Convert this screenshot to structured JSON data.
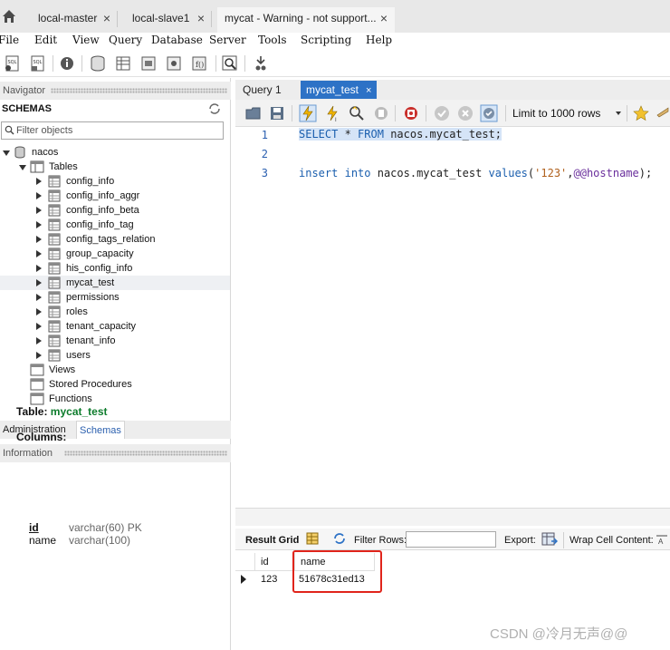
{
  "connection_tabs": [
    {
      "label": "local-master",
      "active": false
    },
    {
      "label": "local-slave1",
      "active": false
    },
    {
      "label": "mycat - Warning - not support...",
      "active": true
    }
  ],
  "menu": [
    "File",
    "Edit",
    "View",
    "Query",
    "Database",
    "Server",
    "Tools",
    "Scripting",
    "Help"
  ],
  "navigator": {
    "header": "Navigator",
    "schemas_title": "SCHEMAS",
    "filter_placeholder": "Filter objects",
    "schema_name": "nacos",
    "tables_label": "Tables",
    "tables": [
      "config_info",
      "config_info_aggr",
      "config_info_beta",
      "config_info_tag",
      "config_tags_relation",
      "group_capacity",
      "his_config_info",
      "mycat_test",
      "permissions",
      "roles",
      "tenant_capacity",
      "tenant_info",
      "users"
    ],
    "selected_table": "mycat_test",
    "views_label": "Views",
    "procedures_label": "Stored Procedures",
    "functions_label": "Functions"
  },
  "bottom_tabs": {
    "administration": "Administration",
    "schemas": "Schemas"
  },
  "information": {
    "header": "Information",
    "table_label": "Table:",
    "table_name": "mycat_test",
    "columns_label": "Columns:",
    "columns": [
      {
        "name": "id",
        "type": "varchar(60) PK"
      },
      {
        "name": "name",
        "type": "varchar(100)"
      }
    ]
  },
  "query_tabs": [
    {
      "label": "Query 1",
      "active": false
    },
    {
      "label": "mycat_test",
      "active": true
    }
  ],
  "query_toolbar": {
    "limit_label": "Limit to 1000 rows"
  },
  "editor": {
    "lines": [
      {
        "num": "1",
        "text": "SELECT * FROM nacos.mycat_test;"
      },
      {
        "num": "2",
        "text": ""
      },
      {
        "num": "3",
        "text": "insert into nacos.mycat_test values('123',@@hostname);"
      }
    ]
  },
  "result_toolbar": {
    "result_grid": "Result Grid",
    "filter_rows": "Filter Rows:",
    "export": "Export:",
    "wrap_cell": "Wrap Cell Content:"
  },
  "result_grid": {
    "columns": [
      "id",
      "name"
    ],
    "rows": [
      [
        "123",
        "51678c31ed13"
      ]
    ]
  },
  "watermark": "CSDN @冷月无声@@",
  "colors": {
    "accent": "#2d72c6",
    "highlight_box": "#e0241b",
    "table_name": "#0d7c2c"
  }
}
